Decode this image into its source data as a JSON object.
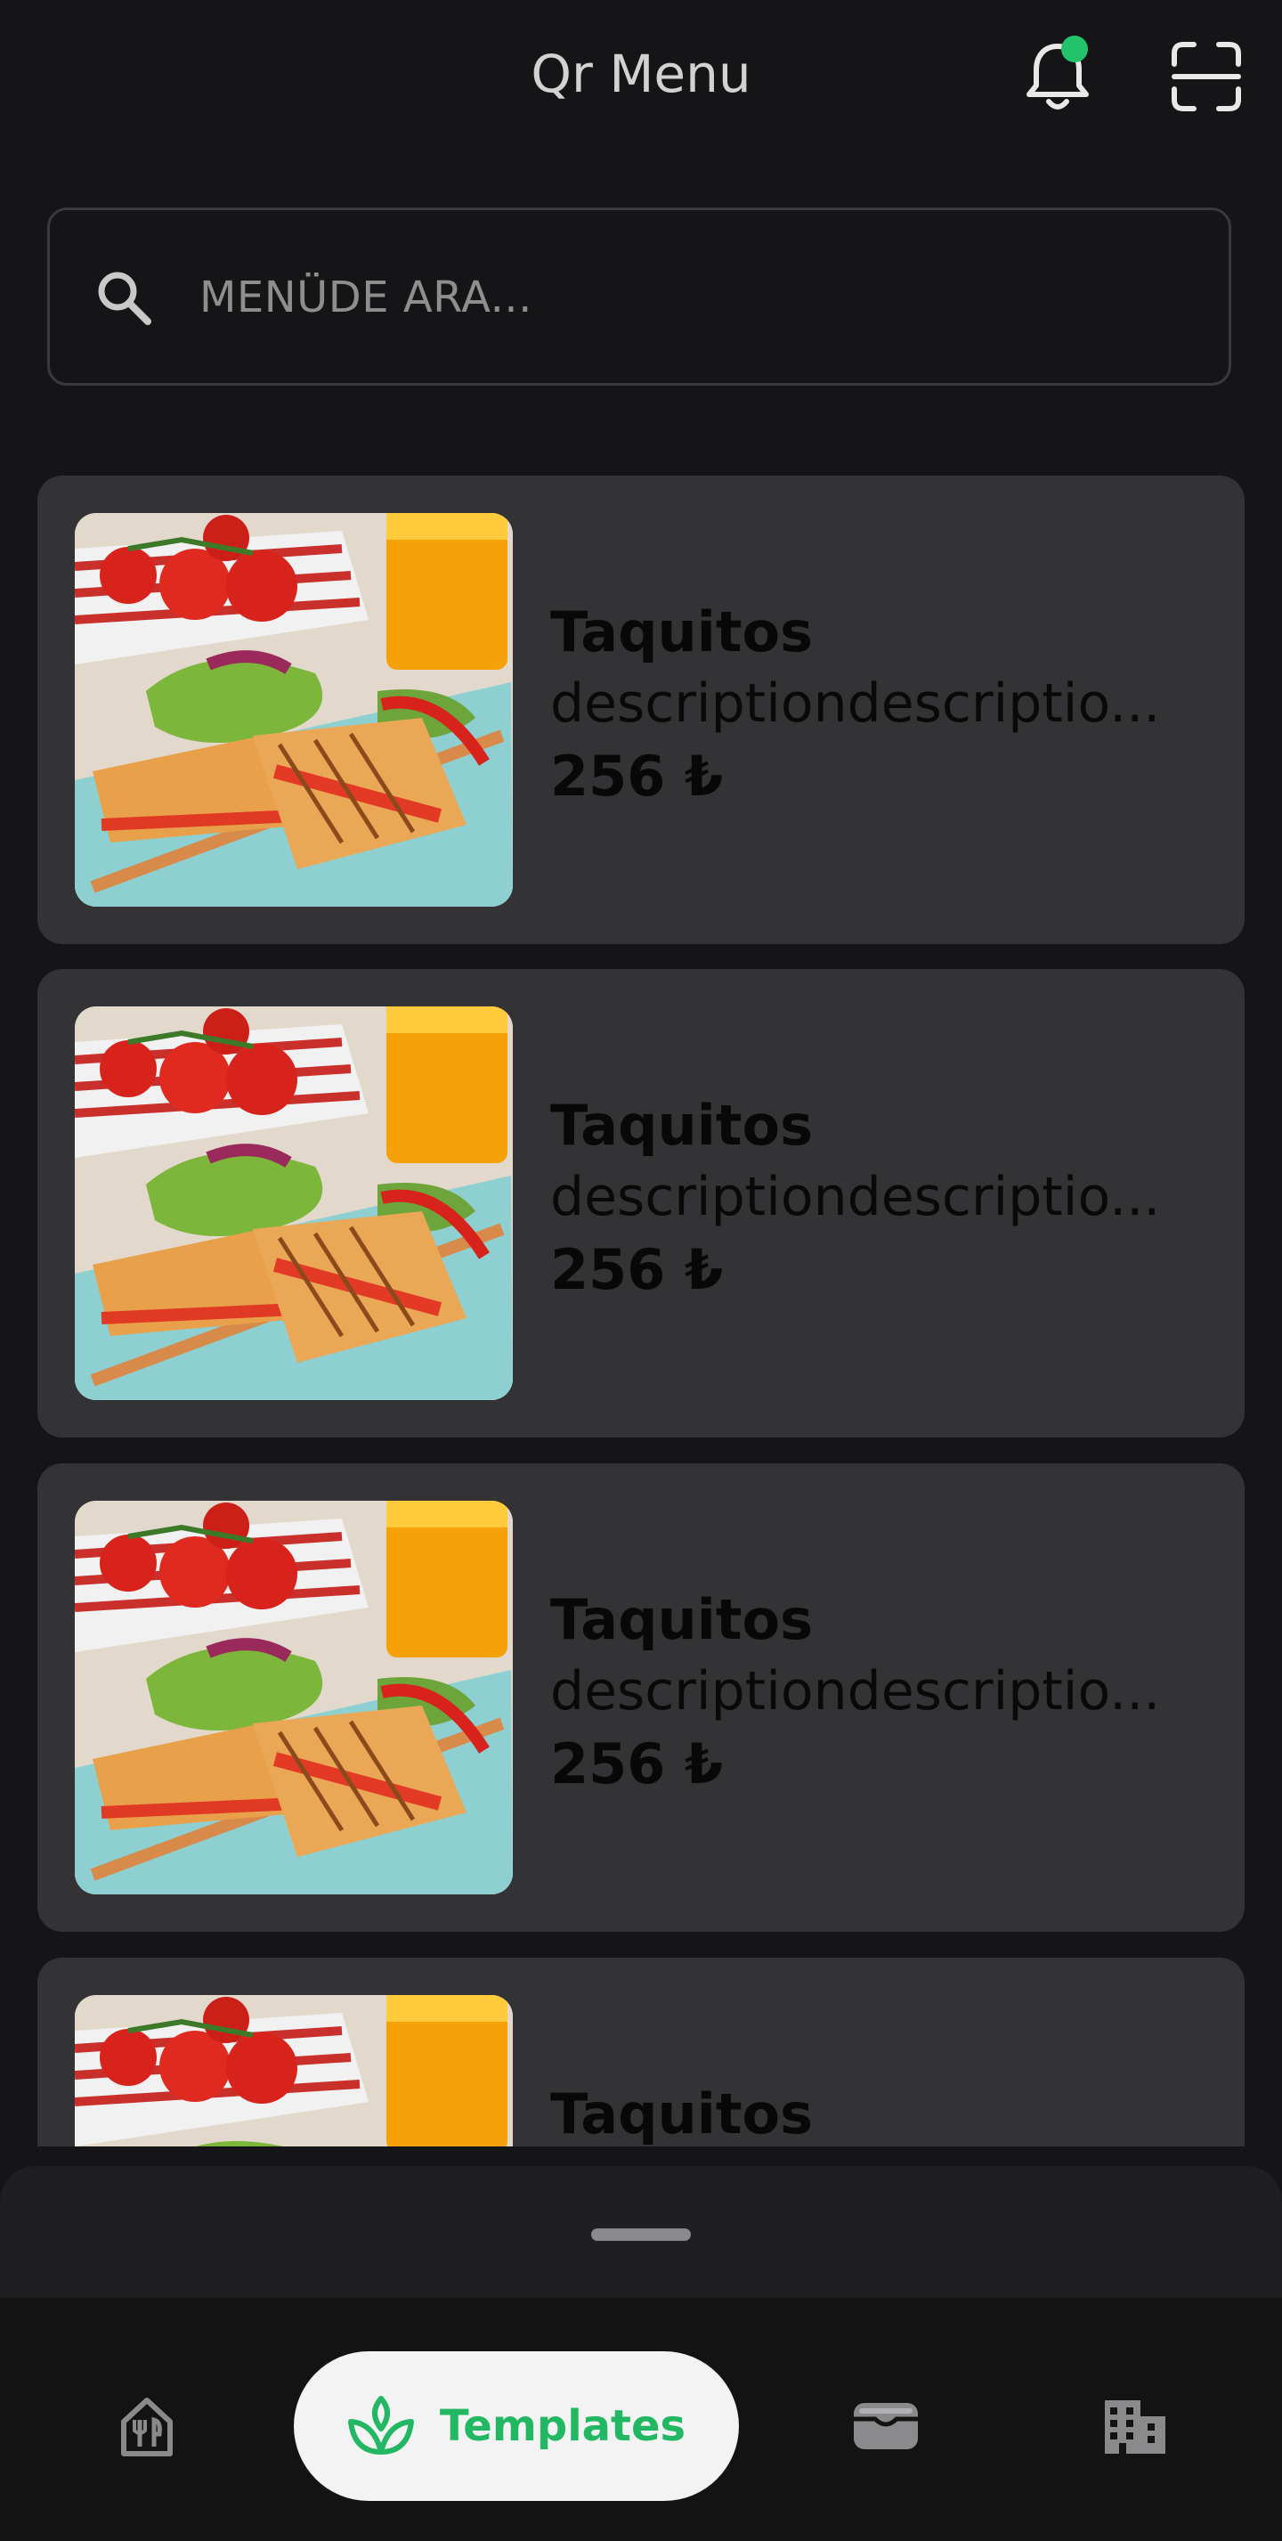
{
  "header": {
    "title": "Qr Menu",
    "notification_icon": "bell-icon",
    "notification_dot_color": "#22c36b",
    "scan_icon": "qr-scan-icon"
  },
  "search": {
    "placeholder": "MENÜDE ARA...",
    "value": "",
    "icon": "search-icon"
  },
  "menu_items": [
    {
      "name": "Taquitos",
      "description": "descriptiondescriptio...",
      "price": "256 ₺",
      "image": "sandwich-plate-image"
    },
    {
      "name": "Taquitos",
      "description": "descriptiondescriptio...",
      "price": "256 ₺",
      "image": "sandwich-plate-image"
    },
    {
      "name": "Taquitos",
      "description": "descriptiondescriptio...",
      "price": "256 ₺",
      "image": "sandwich-plate-image"
    },
    {
      "name": "Taquitos",
      "description": "",
      "price": "",
      "image": "sandwich-plate-image"
    }
  ],
  "bottom_nav": {
    "items": [
      {
        "icon": "restaurant-icon",
        "label": ""
      },
      {
        "icon": "sprout-icon",
        "label": "Templates",
        "active": true
      },
      {
        "icon": "wallet-icon",
        "label": ""
      },
      {
        "icon": "building-icon",
        "label": ""
      }
    ],
    "active_color": "#22b863"
  }
}
